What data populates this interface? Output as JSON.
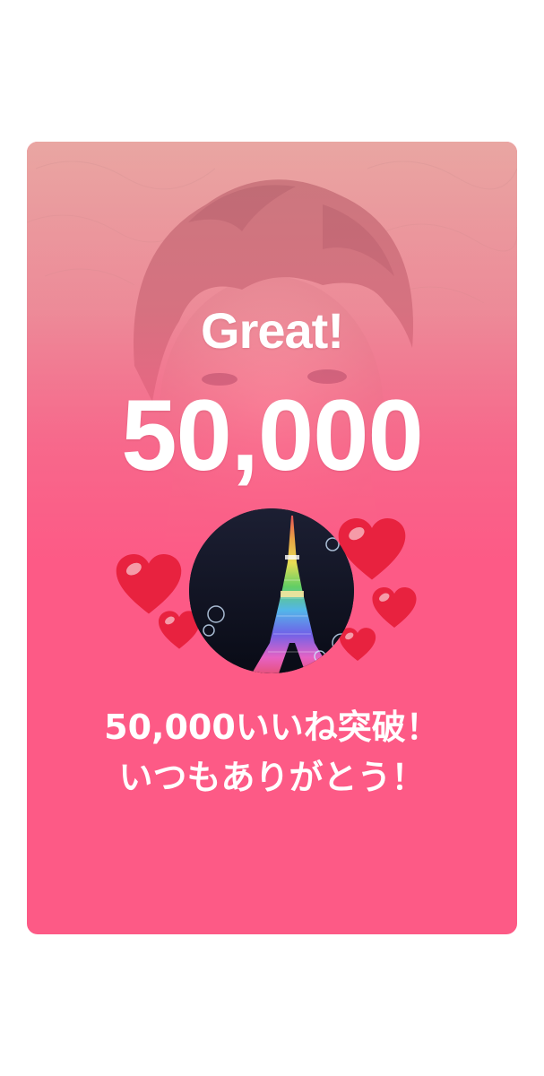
{
  "header": {
    "great_label": "Great!",
    "count_label": "50,000"
  },
  "message": {
    "line1": "50,000いいね突破！",
    "line2": "いつもありがとう！"
  },
  "avatar": {
    "icon": "tokyo-tower-photo"
  },
  "decorations": {
    "heart_icon": "heart-icon",
    "heart_color": "#e8223f"
  },
  "colors": {
    "card_background": "#fd5a86",
    "page_background": "#ffffff",
    "text": "#ffffff"
  }
}
